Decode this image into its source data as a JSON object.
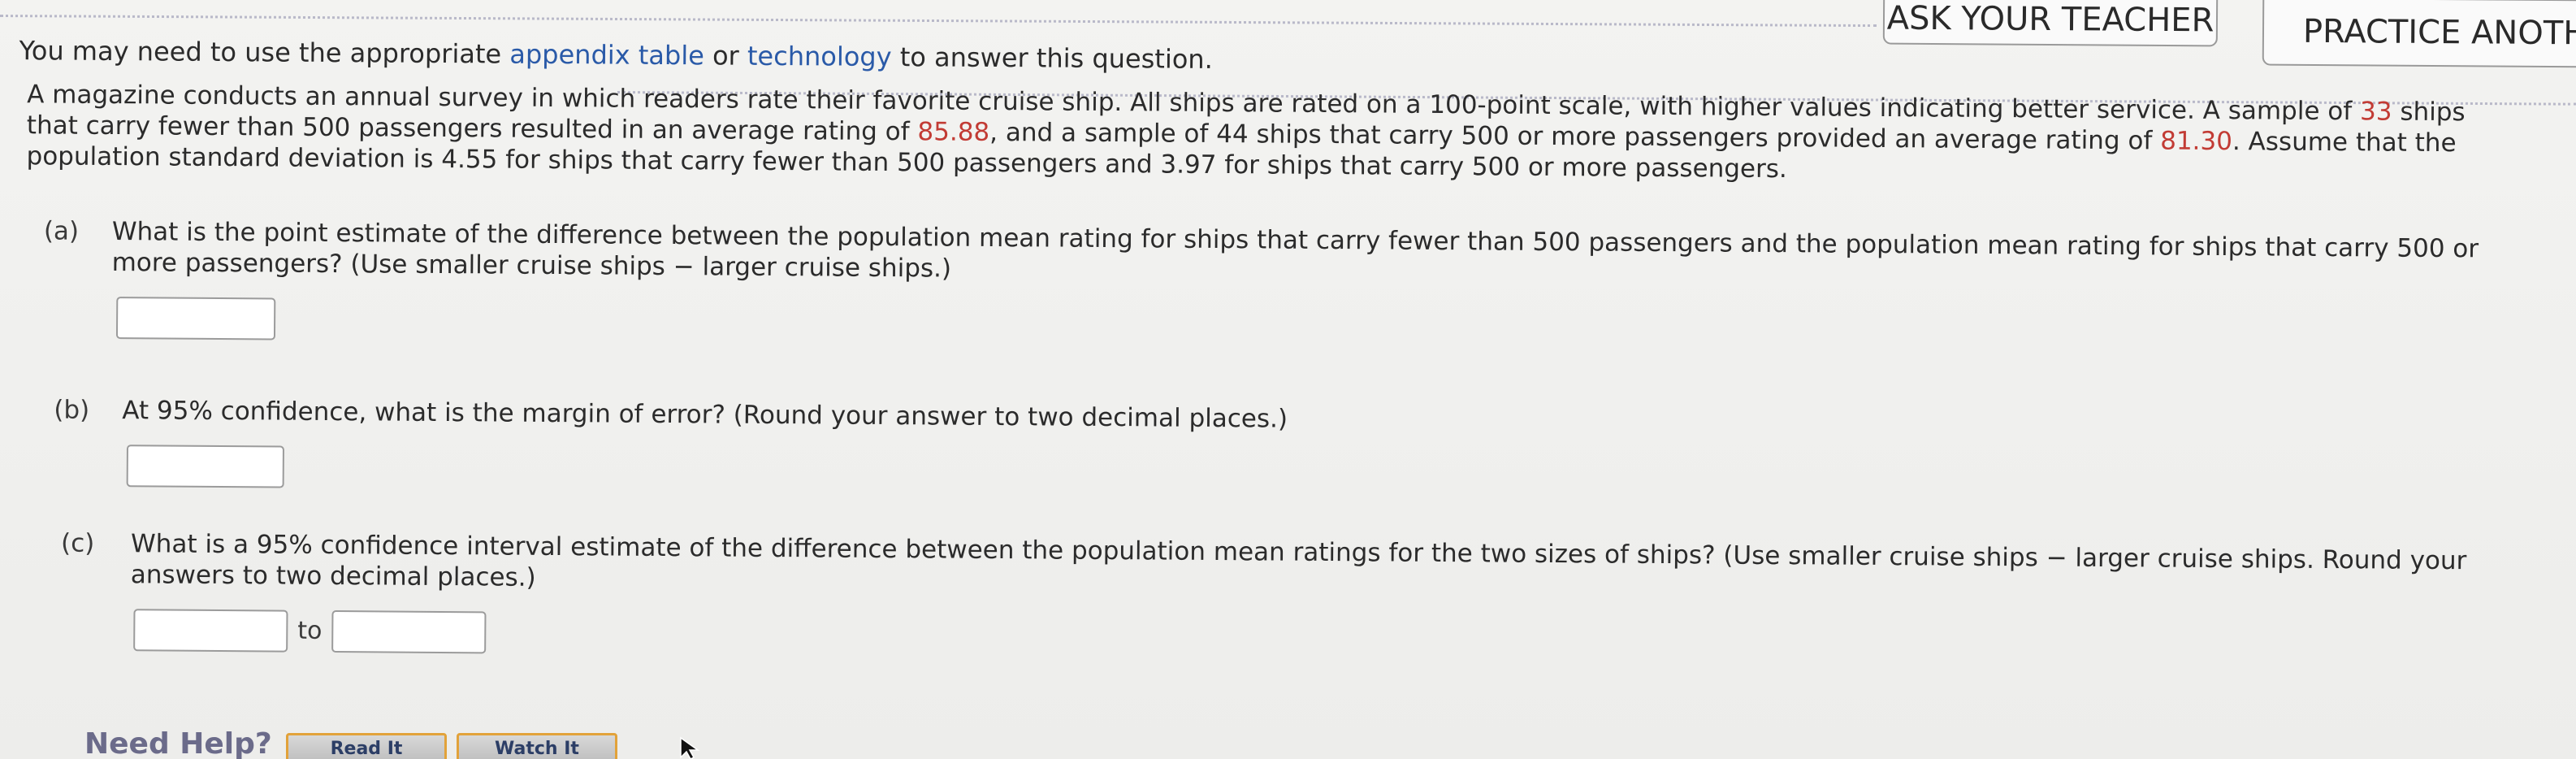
{
  "header": {
    "ask_teacher": "ASK YOUR TEACHER",
    "practice_another": "PRACTICE ANOTHE"
  },
  "intro": {
    "prefix": "You may need to use the appropriate ",
    "link1": "appendix table",
    "middle": " or ",
    "link2": "technology",
    "suffix": " to answer this question."
  },
  "problem": {
    "line1": "A magazine conducts an annual survey in which readers rate their favorite cruise ship. All ships are rated on a 100-point scale, with higher values indicating better service. A sample of ",
    "n1": "33",
    "line1_end": " ships",
    "line2_a": "that carry fewer than 500 passengers resulted in an average rating of ",
    "mean1": "85.88",
    "line2_b": ", and a sample of 44 ships that carry 500 or more passengers provided an average rating of ",
    "mean2": "81.30",
    "line2_c": ". Assume that the",
    "line3": "population standard deviation is 4.55 for ships that carry fewer than 500 passengers and 3.97 for ships that carry 500 or more passengers."
  },
  "parts": {
    "a": {
      "label": "(a)",
      "line1": "What is the point estimate of the difference between the population mean rating for ships that carry fewer than 500 passengers and the population mean rating for ships that carry 500 or",
      "line2": "more passengers? (Use smaller cruise ships − larger cruise ships.)",
      "value": ""
    },
    "b": {
      "label": "(b)",
      "line1": "At 95% confidence, what is the margin of error? (Round your answer to two decimal places.)",
      "value": ""
    },
    "c": {
      "label": "(c)",
      "line1": "What is a 95% confidence interval estimate of the difference between the population mean ratings for the two sizes of ships? (Use smaller cruise ships − larger cruise ships. Round your",
      "line2": "answers to two decimal places.)",
      "to": "to",
      "lower_value": "",
      "upper_value": ""
    }
  },
  "help": {
    "label": "Need Help?",
    "read_it": "Read It",
    "watch_it": "Watch It"
  }
}
